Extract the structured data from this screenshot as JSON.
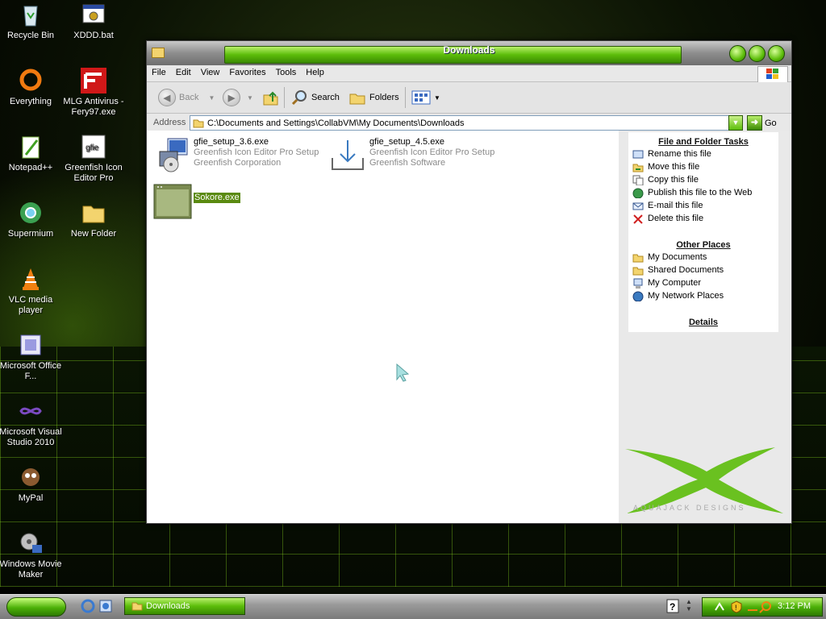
{
  "desktop": {
    "icons": [
      {
        "label": "Recycle Bin",
        "icon": "recycle-bin-icon"
      },
      {
        "label": "XDDD.bat",
        "icon": "batch-file-icon"
      },
      {
        "label": "Everything",
        "icon": "everything-icon"
      },
      {
        "label": "MLG Antivirus - Fery97.exe",
        "icon": "faze-logo-icon"
      },
      {
        "label": "Notepad++",
        "icon": "notepad-plus-plus-icon"
      },
      {
        "label": "Greenfish Icon Editor Pro",
        "icon": "greenfish-icon"
      },
      {
        "label": "Supermium",
        "icon": "supermium-browser-icon"
      },
      {
        "label": "New Folder",
        "icon": "folder-icon"
      },
      {
        "label": "VLC media player",
        "icon": "vlc-cone-icon"
      },
      {
        "label": "Microsoft Office F...",
        "icon": "office-icon"
      },
      {
        "label": "Microsoft Visual Studio 2010",
        "icon": "visual-studio-icon"
      },
      {
        "label": "MyPal",
        "icon": "mypal-icon"
      },
      {
        "label": "Windows Movie Maker",
        "icon": "movie-maker-icon"
      }
    ]
  },
  "window": {
    "title": "Downloads",
    "menu": [
      "File",
      "Edit",
      "View",
      "Favorites",
      "Tools",
      "Help"
    ],
    "toolbar": {
      "back": "Back",
      "search": "Search",
      "folders": "Folders"
    },
    "address": {
      "label": "Address",
      "path": "C:\\Documents and Settings\\CollabVM\\My Documents\\Downloads",
      "go": "Go"
    },
    "files": [
      {
        "name": "gfie_setup_3.6.exe",
        "desc": "Greenfish Icon Editor Pro Setup",
        "company": "Greenfish Corporation"
      },
      {
        "name": "gfie_setup_4.5.exe",
        "desc": "Greenfish Icon Editor Pro Setup",
        "company": "Greenfish Software"
      },
      {
        "name": "Sokore.exe",
        "desc": "",
        "company": ""
      }
    ],
    "tasks": {
      "title": "File and Folder Tasks",
      "items": [
        "Rename this file",
        "Move this file",
        "Copy this file",
        "Publish this file to the Web",
        "E-mail this file",
        "Delete this file"
      ]
    },
    "places": {
      "title": "Other Places",
      "items": [
        "My Documents",
        "Shared Documents",
        "My Computer",
        "My Network Places"
      ]
    },
    "details": {
      "title": "Details"
    },
    "theme_brand": "AQUAJACK DESIGNS"
  },
  "taskbar": {
    "task": "Downloads",
    "clock": "3:12 PM"
  },
  "colors": {
    "accent": "#5cbd0a",
    "dark_accent": "#2b5a04"
  }
}
